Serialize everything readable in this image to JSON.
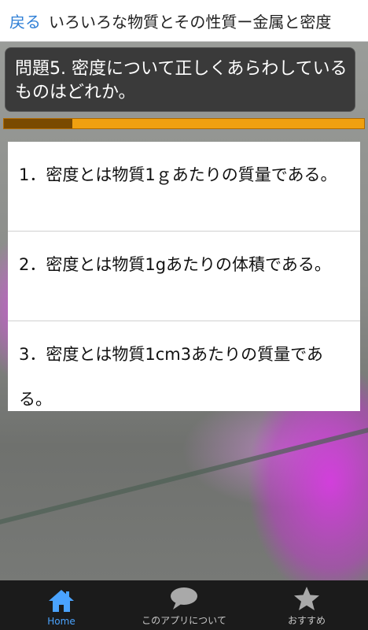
{
  "header": {
    "back_label": "戻る",
    "title": "いろいろな物質とその性質ー金属と密度"
  },
  "question": {
    "text": "問題5. 密度について正しくあらわしているものはどれか。"
  },
  "progress": {
    "fraction": 0.19
  },
  "answers": [
    {
      "text": "1．密度とは物質1ｇあたりの質量である。"
    },
    {
      "text": "2．密度とは物質1gあたりの体積である。"
    },
    {
      "text": "3．密度とは物質1cm3あたりの質量である。"
    }
  ],
  "nav": {
    "items": [
      {
        "label": "Home",
        "icon": "home-icon",
        "active": true
      },
      {
        "label": "このアプリについて",
        "icon": "speech-bubble-icon",
        "active": false
      },
      {
        "label": "おすすめ",
        "icon": "star-icon",
        "active": false
      }
    ]
  },
  "colors": {
    "accent": "#2f7fd6",
    "nav_active": "#4aa3ff",
    "progress_track": "#f0a010",
    "progress_fill": "#7a4a00"
  }
}
